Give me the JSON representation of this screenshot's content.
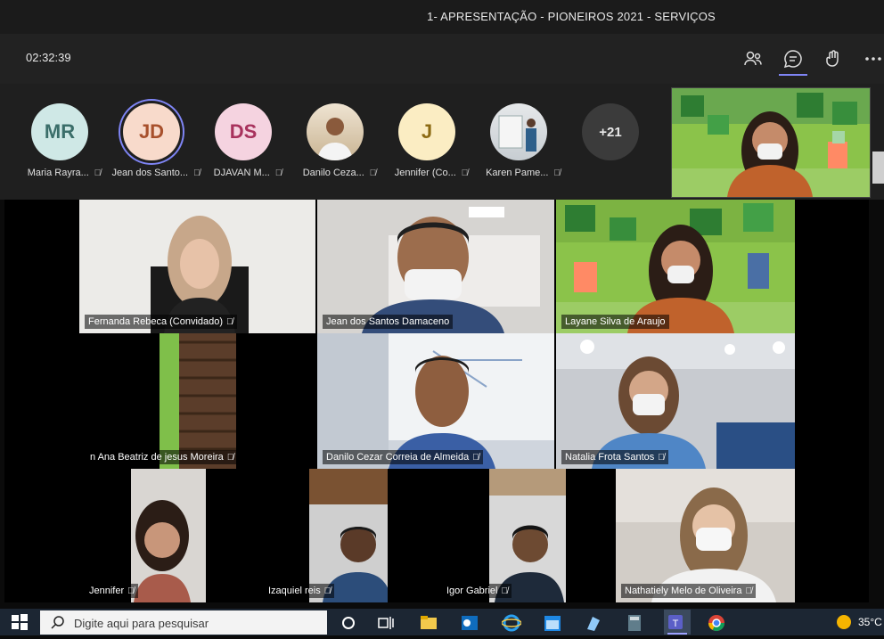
{
  "window": {
    "title": "1- APRESENTAÇÃO - PIONEIROS 2021 - SERVIÇOS"
  },
  "toolbar": {
    "timer": "02:32:39",
    "icons": [
      "people-icon",
      "chat-icon",
      "raise-hand-icon",
      "more-options-icon"
    ]
  },
  "participants_strip": [
    {
      "initials": "MR",
      "name": "Maria Rayra...",
      "bg": "#cfe8e6",
      "fg": "#3b6e6a"
    },
    {
      "initials": "JD",
      "name": "Jean dos Santo...",
      "bg": "#f8dacb",
      "fg": "#a8502c"
    },
    {
      "initials": "DS",
      "name": "DJAVAN M...",
      "bg": "#f5d3e0",
      "fg": "#a8325d"
    },
    {
      "initials": "",
      "name": "Danilo Ceza...",
      "bg": "#d9c7b0",
      "fg": "#333"
    },
    {
      "initials": "J",
      "name": "Jennifer (Co...",
      "bg": "#fbedc3",
      "fg": "#8c6a13"
    },
    {
      "initials": "",
      "name": "Karen Pame...",
      "bg": "#d8dde2",
      "fg": "#333"
    },
    {
      "initials": "+21",
      "name": ""
    }
  ],
  "video_grid": [
    {
      "name": "Fernanda Rebeca (Convidado)"
    },
    {
      "name": "Jean dos Santos Damaceno"
    },
    {
      "name": "Layane Silva de Araujo"
    },
    {
      "name": "n Ana Beatriz de jesus Moreira"
    },
    {
      "name": "Danilo Cezar Correia de Almeida"
    },
    {
      "name": "Natalia Frota Santos"
    },
    {
      "name": "Jennifer"
    },
    {
      "name": "Izaquiel reis"
    },
    {
      "name": "Igor Gabriel"
    },
    {
      "name": "Nathatiely Melo de Oliveira"
    }
  ],
  "taskbar": {
    "search_placeholder": "Digite aqui para pesquisar",
    "temperature": "35°C"
  }
}
